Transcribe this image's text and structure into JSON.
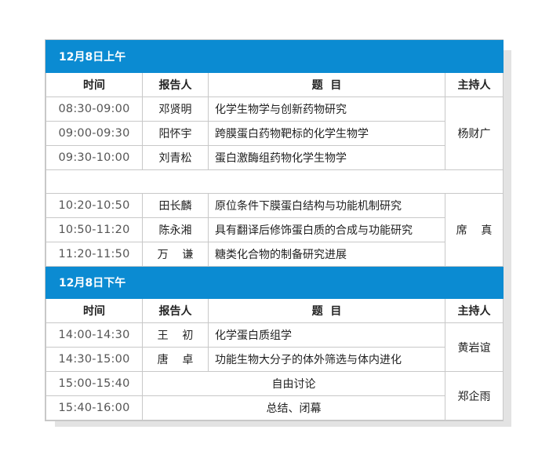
{
  "sections": [
    {
      "title": "12月8日上午",
      "headers": {
        "time": "时间",
        "speaker": "报告人",
        "topic": "题  目",
        "host": "主持人"
      },
      "rows": [
        {
          "time": "08:30-09:00",
          "speaker": "邓贤明",
          "topic": "化学生物学与创新药物研究"
        },
        {
          "time": "09:00-09:30",
          "speaker": "阳怀宇",
          "topic": "跨膜蛋白药物靶标的化学生物学"
        },
        {
          "time": "09:30-10:00",
          "speaker": "刘青松",
          "topic": "蛋白激酶组药物化学生物学"
        }
      ],
      "host1": "杨财广",
      "rows2": [
        {
          "time": "10:20-10:50",
          "speaker": "田长麟",
          "topic": "原位条件下膜蛋白结构与功能机制研究"
        },
        {
          "time": "10:50-11:20",
          "speaker": "陈永湘",
          "topic": "具有翻译后修饰蛋白质的合成与功能研究"
        },
        {
          "time": "11:20-11:50",
          "speaker": "万    谦",
          "topic": "糖类化合物的制备研究进展"
        }
      ],
      "host2": "席    真"
    },
    {
      "title": "12月8日下午",
      "headers": {
        "time": "时间",
        "speaker": "报告人",
        "topic": "题  目",
        "host": "主持人"
      },
      "rows": [
        {
          "time": "14:00-14:30",
          "speaker": "王    初",
          "topic": "化学蛋白质组学"
        },
        {
          "time": "14:30-15:00",
          "speaker": "唐    卓",
          "topic": "功能生物大分子的体外筛选与体内进化"
        }
      ],
      "host1": "黄岩谊",
      "rows2": [
        {
          "time": "15:00-15:40",
          "activity": "自由讨论"
        },
        {
          "time": "15:40-16:00",
          "activity": "总结、闭幕"
        }
      ],
      "host2": "郑企雨"
    }
  ],
  "colors": {
    "header_bg": "#0b8bd2",
    "border": "#c8c8c8",
    "shadow": "#e3e3e3"
  }
}
